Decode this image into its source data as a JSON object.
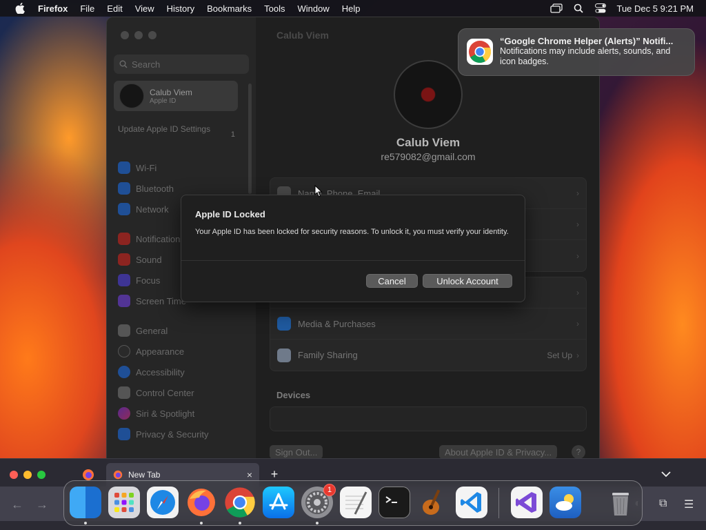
{
  "menubar": {
    "app_name": "Firefox",
    "items": [
      "File",
      "Edit",
      "View",
      "History",
      "Bookmarks",
      "Tools",
      "Window",
      "Help"
    ],
    "clock": "Tue Dec 5  9:21 PM"
  },
  "settings": {
    "search_placeholder": "Search",
    "user": {
      "name": "Calub Viem",
      "subtitle": "Apple ID"
    },
    "update": {
      "label": "Update Apple ID Settings",
      "badge": "1"
    },
    "sidebar_items": [
      {
        "label": "Wi-Fi",
        "color": "#2a6fd6"
      },
      {
        "label": "Bluetooth",
        "color": "#2a6fd6"
      },
      {
        "label": "Network",
        "color": "#2a6fd6"
      },
      {
        "label": "Notifications",
        "color": "#d6332a"
      },
      {
        "label": "Sound",
        "color": "#d6332a"
      },
      {
        "label": "Focus",
        "color": "#5b4bd6"
      },
      {
        "label": "Screen Time",
        "color": "#7b4bd6"
      },
      {
        "label": "General",
        "color": "#8a8a8a"
      },
      {
        "label": "Appearance",
        "color": "#333333"
      },
      {
        "label": "Accessibility",
        "color": "#2a6fd6"
      },
      {
        "label": "Control Center",
        "color": "#8a8a8a"
      },
      {
        "label": "Siri & Spotlight",
        "color": "#c23bd6"
      },
      {
        "label": "Privacy & Security",
        "color": "#2a6fd6"
      }
    ],
    "main_title": "Calub Viem",
    "profile_name": "Calub Viem",
    "profile_email": "re579082@gmail.com",
    "rows_top": [
      {
        "label": "Name, Phone, Email"
      }
    ],
    "rows_mid": [
      {
        "label": "Media & Purchases",
        "aside": ""
      },
      {
        "label": "Family Sharing",
        "aside": "Set Up"
      }
    ],
    "devices_label": "Devices",
    "sign_out": "Sign Out...",
    "about": "About Apple ID & Privacy...",
    "help": "?"
  },
  "dialog": {
    "title": "Apple ID Locked",
    "message": "Your Apple ID has been locked for security reasons. To unlock it, you must verify your identity.",
    "cancel": "Cancel",
    "confirm": "Unlock Account"
  },
  "notification": {
    "title": "“Google Chrome Helper (Alerts)” Notifi...",
    "body": "Notifications may include alerts, sounds, and icon badges."
  },
  "firefox": {
    "tab_title": "New Tab",
    "new_tab": "+",
    "close": "×"
  },
  "dock": {
    "apps": [
      "Finder",
      "Launchpad",
      "Safari",
      "Firefox",
      "Google Chrome",
      "App Store",
      "System Settings",
      "TextEdit",
      "Terminal",
      "GarageBand",
      "Visual Studio Code",
      "Visual Studio",
      "Weather",
      "Trash"
    ],
    "settings_badge": "1"
  }
}
